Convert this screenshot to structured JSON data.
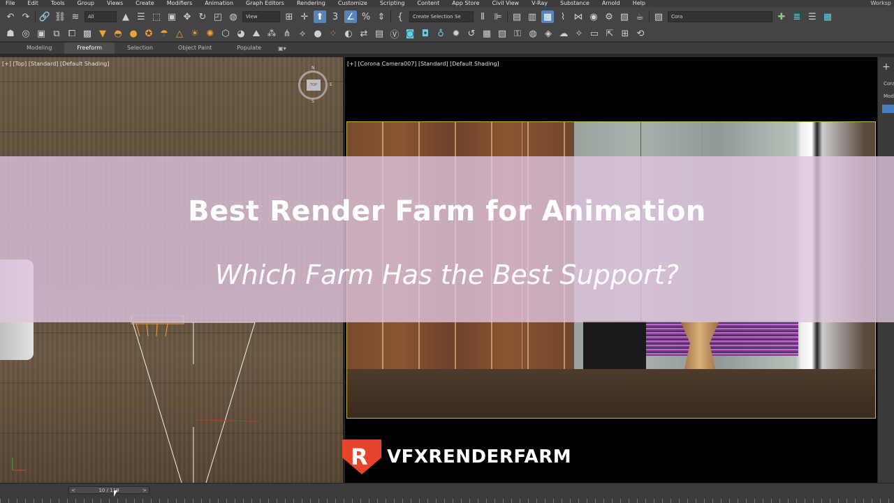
{
  "menu": {
    "items": [
      "File",
      "Edit",
      "Tools",
      "Group",
      "Views",
      "Create",
      "Modifiers",
      "Animation",
      "Graph Editors",
      "Rendering",
      "Customize",
      "Scripting",
      "Content",
      "App Store",
      "Civil View",
      "V-Ray",
      "Substance",
      "Arnold",
      "Help"
    ],
    "workspace": "Worksp"
  },
  "toolbar": {
    "selection_filter": "All",
    "reference_coord": "View",
    "named_selection": "Create Selection Se",
    "search_value": "Cora"
  },
  "ribbon": {
    "tabs": [
      "Modeling",
      "Freeform",
      "Selection",
      "Object Paint",
      "Populate"
    ],
    "active_tab": "Freeform",
    "options_icon": "dropdown-options-icon"
  },
  "viewports": {
    "left": {
      "label": "[+] [Top] [Standard] [Default Shading]"
    },
    "right": {
      "label": "[+] [Corona Camera007] [Standard] [Default Shading]"
    }
  },
  "viewcube": {
    "face": "TOP",
    "n": "N",
    "s": "S",
    "e": "E"
  },
  "command_panel": {
    "labels": [
      "Cora",
      "Mod"
    ]
  },
  "timeline": {
    "frame": "10 / 119",
    "prev": "<",
    "next": ">"
  },
  "banner": {
    "title": "Best Render Farm for Animation",
    "subtitle": "Which Farm Has the Best Support?"
  },
  "logo": {
    "text": "VFXRENDERFARM",
    "mark_letter": "R",
    "color": "#e8432d"
  }
}
